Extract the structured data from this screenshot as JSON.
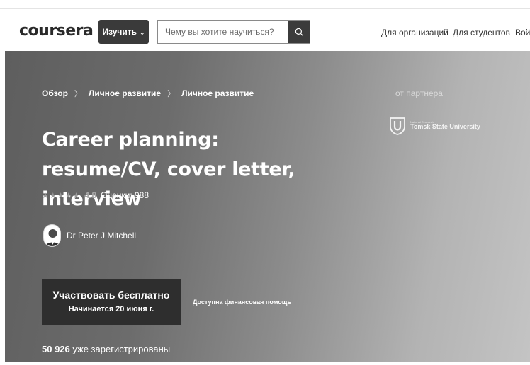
{
  "header": {
    "logo": "coursera",
    "explore_label": "Изучить",
    "search_placeholder": "Чему вы хотите научиться?",
    "nav": [
      "Для организаций",
      "Для студентов",
      "Войт"
    ]
  },
  "hero": {
    "breadcrumbs": [
      "Обзор",
      "Личное развитие",
      "Личное развитие"
    ],
    "title": "Career planning: resume/CV, cover letter, interview",
    "rating_value": "4.8",
    "rating_count": "Оценки: 988",
    "instructor": "Dr Peter J Mitchell",
    "cta_main": "Участвовать бесплатно",
    "cta_sub": "Начинается 20 июня г.",
    "financial_aid": "Доступна финансовая помощь",
    "enrolled_count": "50 926",
    "enrolled_text": " уже зарегистрированы",
    "partner_label": "от партнера",
    "partner_small": "National Research",
    "partner_name": "Tomsk State University"
  },
  "colors": {
    "cta_bg": "#2e2e2e",
    "explore_bg": "#3a3a3a",
    "hero_start": "#5e5e5e",
    "hero_end": "#c4c4c4"
  }
}
